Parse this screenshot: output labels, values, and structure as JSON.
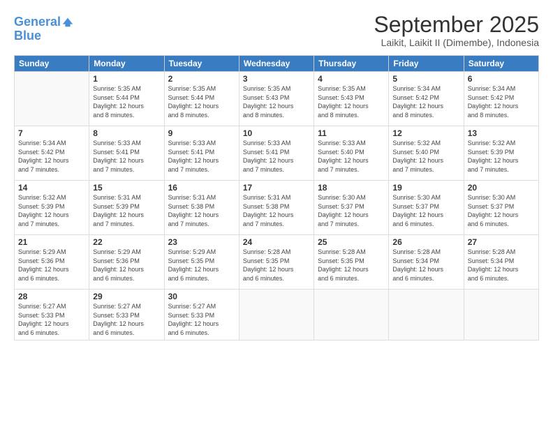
{
  "header": {
    "logo_line1": "General",
    "logo_line2": "Blue",
    "title": "September 2025",
    "subtitle": "Laikit, Laikit II (Dimembe), Indonesia"
  },
  "days_of_week": [
    "Sunday",
    "Monday",
    "Tuesday",
    "Wednesday",
    "Thursday",
    "Friday",
    "Saturday"
  ],
  "weeks": [
    [
      {
        "day": "",
        "content": ""
      },
      {
        "day": "1",
        "content": "Sunrise: 5:35 AM\nSunset: 5:44 PM\nDaylight: 12 hours\nand 8 minutes."
      },
      {
        "day": "2",
        "content": "Sunrise: 5:35 AM\nSunset: 5:44 PM\nDaylight: 12 hours\nand 8 minutes."
      },
      {
        "day": "3",
        "content": "Sunrise: 5:35 AM\nSunset: 5:43 PM\nDaylight: 12 hours\nand 8 minutes."
      },
      {
        "day": "4",
        "content": "Sunrise: 5:35 AM\nSunset: 5:43 PM\nDaylight: 12 hours\nand 8 minutes."
      },
      {
        "day": "5",
        "content": "Sunrise: 5:34 AM\nSunset: 5:42 PM\nDaylight: 12 hours\nand 8 minutes."
      },
      {
        "day": "6",
        "content": "Sunrise: 5:34 AM\nSunset: 5:42 PM\nDaylight: 12 hours\nand 8 minutes."
      }
    ],
    [
      {
        "day": "7",
        "content": "Sunrise: 5:34 AM\nSunset: 5:42 PM\nDaylight: 12 hours\nand 7 minutes."
      },
      {
        "day": "8",
        "content": "Sunrise: 5:33 AM\nSunset: 5:41 PM\nDaylight: 12 hours\nand 7 minutes."
      },
      {
        "day": "9",
        "content": "Sunrise: 5:33 AM\nSunset: 5:41 PM\nDaylight: 12 hours\nand 7 minutes."
      },
      {
        "day": "10",
        "content": "Sunrise: 5:33 AM\nSunset: 5:41 PM\nDaylight: 12 hours\nand 7 minutes."
      },
      {
        "day": "11",
        "content": "Sunrise: 5:33 AM\nSunset: 5:40 PM\nDaylight: 12 hours\nand 7 minutes."
      },
      {
        "day": "12",
        "content": "Sunrise: 5:32 AM\nSunset: 5:40 PM\nDaylight: 12 hours\nand 7 minutes."
      },
      {
        "day": "13",
        "content": "Sunrise: 5:32 AM\nSunset: 5:39 PM\nDaylight: 12 hours\nand 7 minutes."
      }
    ],
    [
      {
        "day": "14",
        "content": "Sunrise: 5:32 AM\nSunset: 5:39 PM\nDaylight: 12 hours\nand 7 minutes."
      },
      {
        "day": "15",
        "content": "Sunrise: 5:31 AM\nSunset: 5:39 PM\nDaylight: 12 hours\nand 7 minutes."
      },
      {
        "day": "16",
        "content": "Sunrise: 5:31 AM\nSunset: 5:38 PM\nDaylight: 12 hours\nand 7 minutes."
      },
      {
        "day": "17",
        "content": "Sunrise: 5:31 AM\nSunset: 5:38 PM\nDaylight: 12 hours\nand 7 minutes."
      },
      {
        "day": "18",
        "content": "Sunrise: 5:30 AM\nSunset: 5:37 PM\nDaylight: 12 hours\nand 7 minutes."
      },
      {
        "day": "19",
        "content": "Sunrise: 5:30 AM\nSunset: 5:37 PM\nDaylight: 12 hours\nand 6 minutes."
      },
      {
        "day": "20",
        "content": "Sunrise: 5:30 AM\nSunset: 5:37 PM\nDaylight: 12 hours\nand 6 minutes."
      }
    ],
    [
      {
        "day": "21",
        "content": "Sunrise: 5:29 AM\nSunset: 5:36 PM\nDaylight: 12 hours\nand 6 minutes."
      },
      {
        "day": "22",
        "content": "Sunrise: 5:29 AM\nSunset: 5:36 PM\nDaylight: 12 hours\nand 6 minutes."
      },
      {
        "day": "23",
        "content": "Sunrise: 5:29 AM\nSunset: 5:35 PM\nDaylight: 12 hours\nand 6 minutes."
      },
      {
        "day": "24",
        "content": "Sunrise: 5:28 AM\nSunset: 5:35 PM\nDaylight: 12 hours\nand 6 minutes."
      },
      {
        "day": "25",
        "content": "Sunrise: 5:28 AM\nSunset: 5:35 PM\nDaylight: 12 hours\nand 6 minutes."
      },
      {
        "day": "26",
        "content": "Sunrise: 5:28 AM\nSunset: 5:34 PM\nDaylight: 12 hours\nand 6 minutes."
      },
      {
        "day": "27",
        "content": "Sunrise: 5:28 AM\nSunset: 5:34 PM\nDaylight: 12 hours\nand 6 minutes."
      }
    ],
    [
      {
        "day": "28",
        "content": "Sunrise: 5:27 AM\nSunset: 5:33 PM\nDaylight: 12 hours\nand 6 minutes."
      },
      {
        "day": "29",
        "content": "Sunrise: 5:27 AM\nSunset: 5:33 PM\nDaylight: 12 hours\nand 6 minutes."
      },
      {
        "day": "30",
        "content": "Sunrise: 5:27 AM\nSunset: 5:33 PM\nDaylight: 12 hours\nand 6 minutes."
      },
      {
        "day": "",
        "content": ""
      },
      {
        "day": "",
        "content": ""
      },
      {
        "day": "",
        "content": ""
      },
      {
        "day": "",
        "content": ""
      }
    ]
  ]
}
